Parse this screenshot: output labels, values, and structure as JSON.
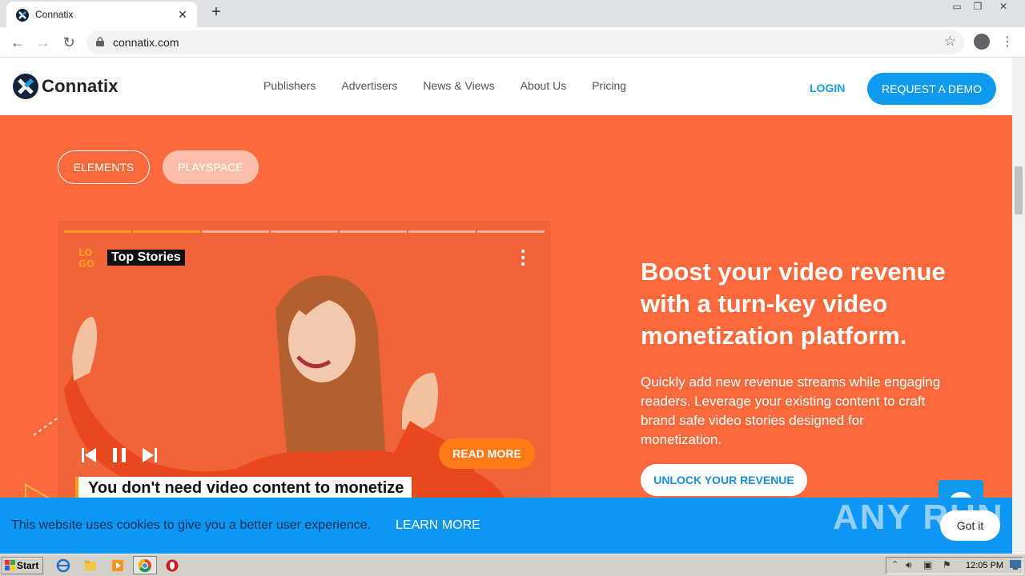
{
  "browser": {
    "tab_title": "Connatix",
    "new_tab": "+",
    "close_tab": "✕",
    "url": "connatix.com",
    "window_controls": [
      "▭",
      "❐",
      "✕"
    ]
  },
  "header": {
    "brand": "Connatix",
    "nav": [
      "Publishers",
      "Advertisers",
      "News & Views",
      "About Us",
      "Pricing"
    ],
    "login": "LOGIN",
    "demo": "REQUEST A DEMO"
  },
  "hero": {
    "pills": [
      "ELEMENTS",
      "PLAYSPACE"
    ],
    "headline": "Boost your video revenue with a turn-key video monetization platform.",
    "subtext": "Quickly add new revenue streams while engaging readers. Leverage your existing content to craft brand safe video stories designed for monetization.",
    "cta": "UNLOCK YOUR REVENUE"
  },
  "player": {
    "channel": "Top Stories",
    "read_more": "READ MORE",
    "caption": "You don't need video content to monetize",
    "segments": 7,
    "active_segments": 2
  },
  "cookie": {
    "text": "This website uses cookies to give you a better user experience.",
    "link": "LEARN MORE",
    "button": "Got it",
    "watermark": "ANY RUN"
  },
  "taskbar": {
    "start": "Start",
    "clock": "12:05 PM"
  },
  "colors": {
    "hero_bg": "#fb6a3c",
    "brand_blue": "#0f9af0",
    "accent_orange": "#ff7a18"
  }
}
